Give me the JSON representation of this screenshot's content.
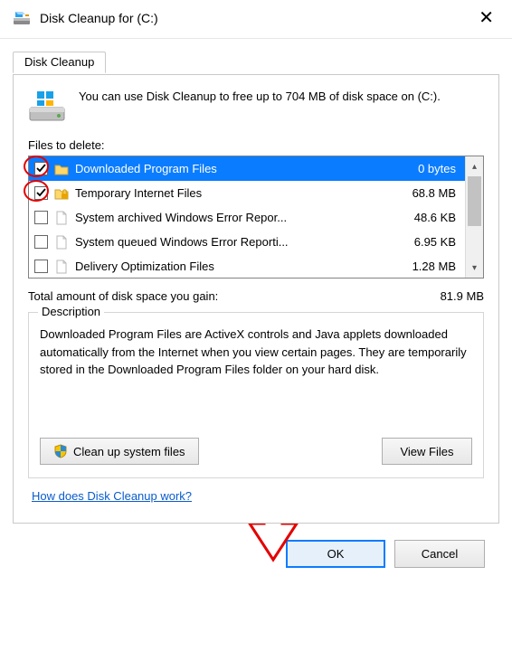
{
  "title": "Disk Cleanup for  (C:)",
  "tab_label": "Disk Cleanup",
  "intro": "You can use Disk Cleanup to free up to 704 MB of disk space on  (C:).",
  "files_to_delete_label": "Files to delete:",
  "rows": [
    {
      "name": "Downloaded Program Files",
      "size": "0 bytes",
      "checked": true,
      "selected": true,
      "icon": "folder"
    },
    {
      "name": "Temporary Internet Files",
      "size": "68.8 MB",
      "checked": true,
      "selected": false,
      "icon": "lock"
    },
    {
      "name": "System archived Windows Error Repor...",
      "size": "48.6 KB",
      "checked": false,
      "selected": false,
      "icon": "file"
    },
    {
      "name": "System queued Windows Error Reporti...",
      "size": "6.95 KB",
      "checked": false,
      "selected": false,
      "icon": "file"
    },
    {
      "name": "Delivery Optimization Files",
      "size": "1.28 MB",
      "checked": false,
      "selected": false,
      "icon": "file"
    }
  ],
  "total_label": "Total amount of disk space you gain:",
  "total_value": "81.9 MB",
  "description_heading": "Description",
  "description_text": "Downloaded Program Files are ActiveX controls and Java applets downloaded automatically from the Internet when you view certain pages. They are temporarily stored in the Downloaded Program Files folder on your hard disk.",
  "clean_system_label": "Clean up system files",
  "view_files_label": "View Files",
  "help_link": "How does Disk Cleanup work?",
  "ok_label": "OK",
  "cancel_label": "Cancel"
}
